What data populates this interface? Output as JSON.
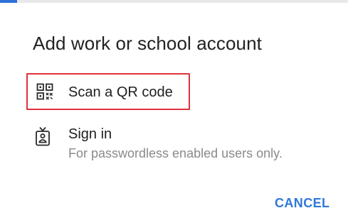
{
  "dialog": {
    "title": "Add work or school account",
    "options": [
      {
        "label": "Scan a QR code",
        "icon": "qr-code-icon",
        "highlighted": true,
        "highlight_color": "#e0313b"
      },
      {
        "label": "Sign in",
        "sublabel": "For passwordless enabled users only.",
        "icon": "badge-icon"
      }
    ],
    "cancel_label": "CANCEL"
  },
  "colors": {
    "accent": "#2f78d8",
    "title_text": "#222222",
    "secondary_text": "#8a8a8a",
    "highlight_border": "#e0313b"
  }
}
